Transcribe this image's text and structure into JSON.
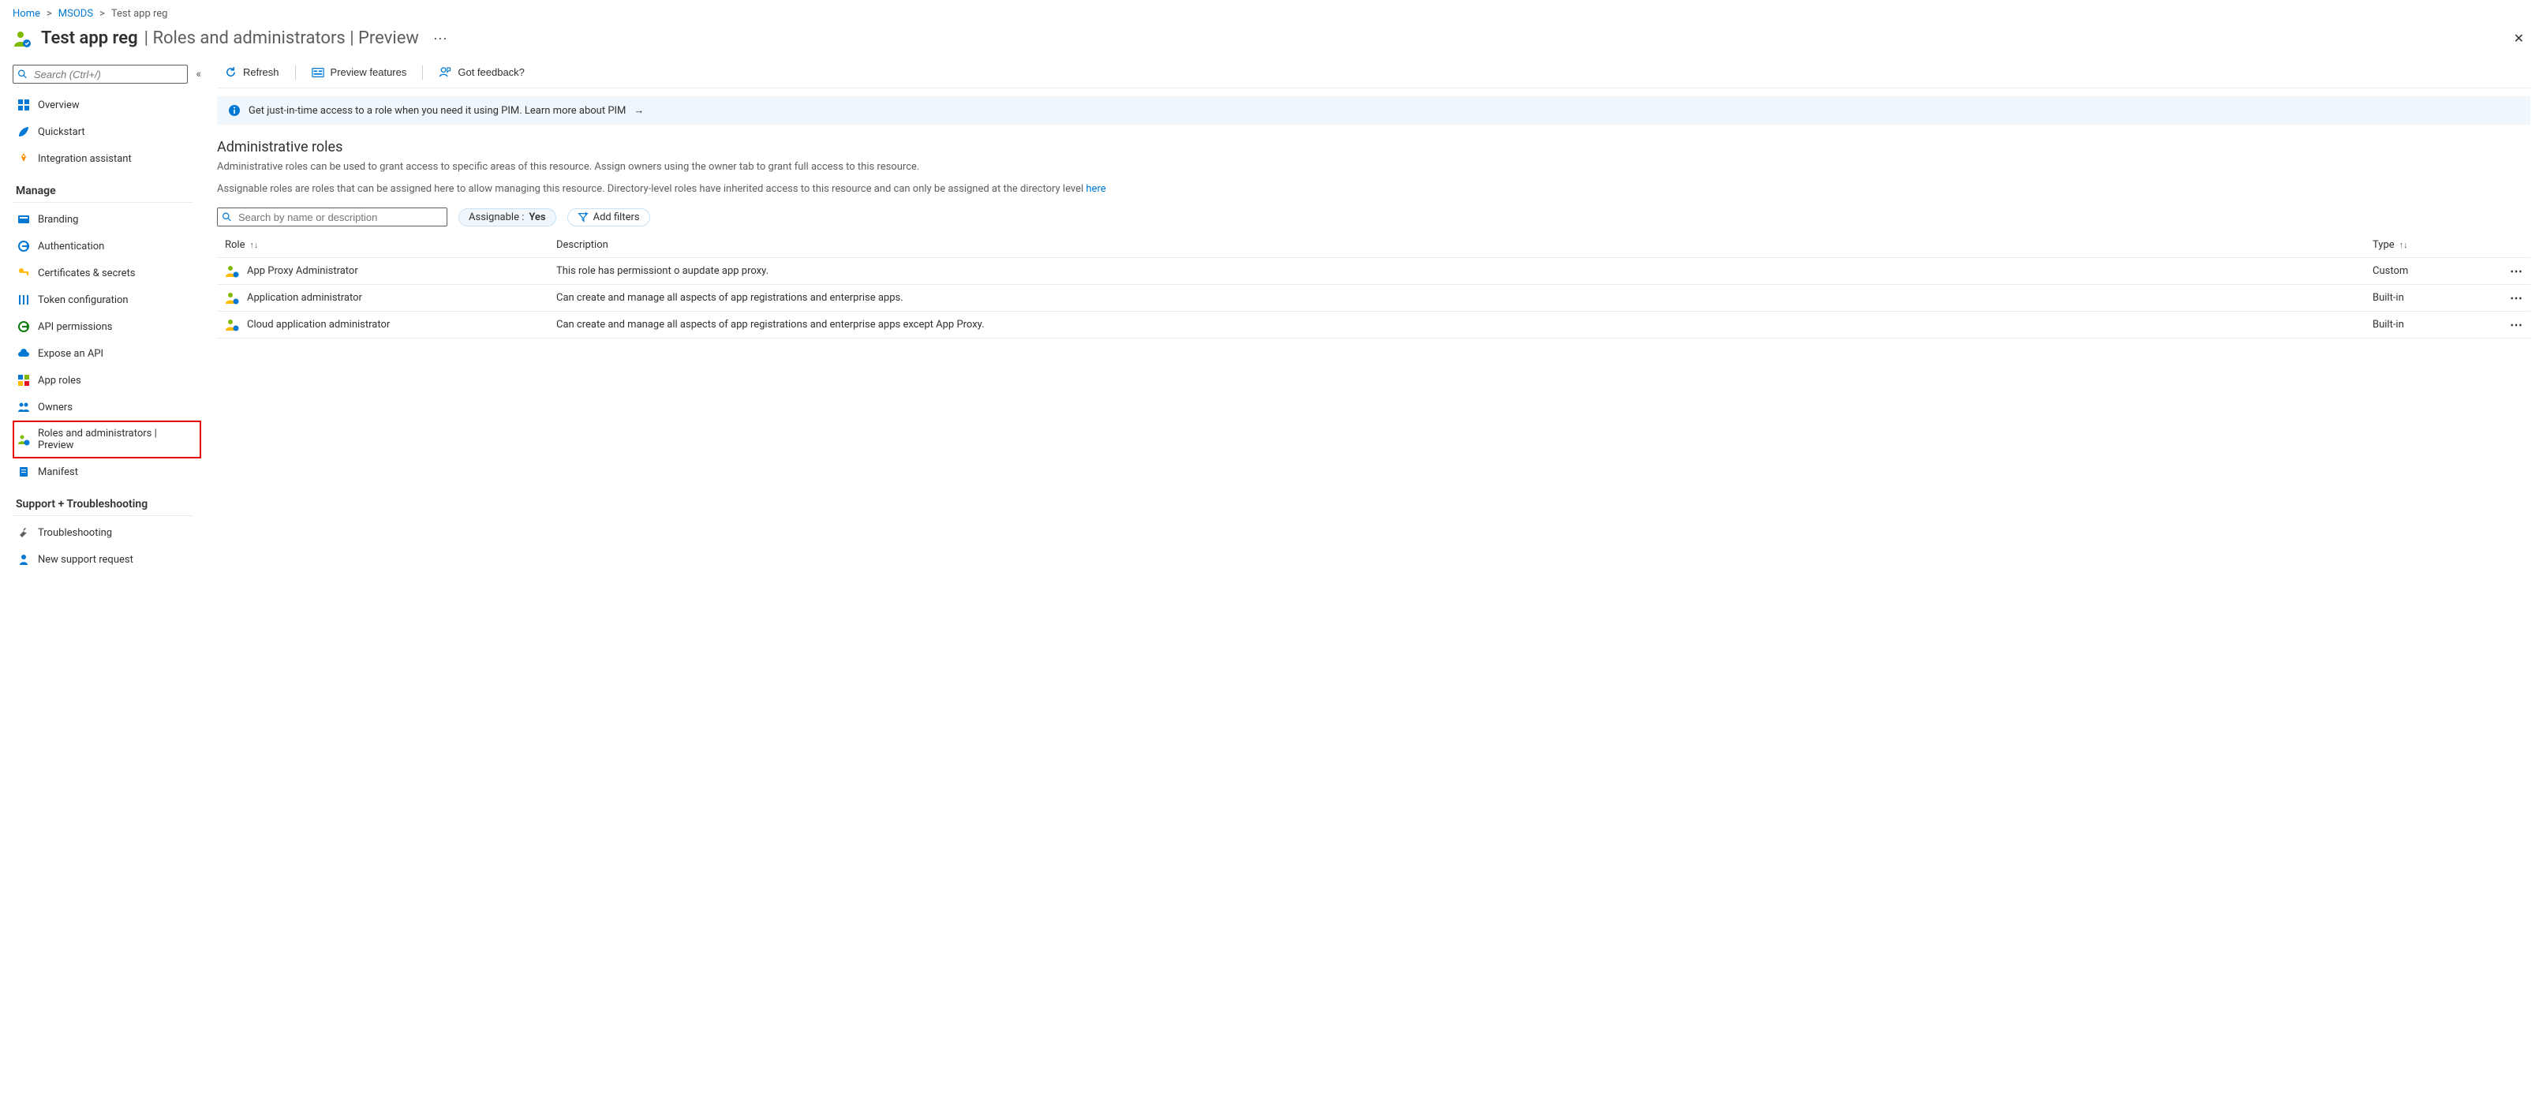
{
  "breadcrumb": {
    "home": "Home",
    "msods": "MSODS",
    "current": "Test app reg"
  },
  "header": {
    "title_strong": "Test app reg",
    "title_sep": " | ",
    "title_light": "Roles and administrators | Preview"
  },
  "sidebar": {
    "search_placeholder": "Search (Ctrl+/)",
    "items_top": [
      {
        "id": "overview",
        "label": "Overview",
        "icon": "overview"
      },
      {
        "id": "quickstart",
        "label": "Quickstart",
        "icon": "quickstart"
      },
      {
        "id": "integration",
        "label": "Integration assistant",
        "icon": "rocket"
      }
    ],
    "section_manage": "Manage",
    "items_manage": [
      {
        "id": "branding",
        "label": "Branding",
        "icon": "branding"
      },
      {
        "id": "authentication",
        "label": "Authentication",
        "icon": "auth"
      },
      {
        "id": "certificates",
        "label": "Certificates & secrets",
        "icon": "key"
      },
      {
        "id": "token-config",
        "label": "Token configuration",
        "icon": "token"
      },
      {
        "id": "api-permissions",
        "label": "API permissions",
        "icon": "api-perm"
      },
      {
        "id": "expose-api",
        "label": "Expose an API",
        "icon": "cloud"
      },
      {
        "id": "app-roles",
        "label": "App roles",
        "icon": "app-roles"
      },
      {
        "id": "owners",
        "label": "Owners",
        "icon": "owners"
      },
      {
        "id": "roles-admins",
        "label": "Roles and administrators | Preview",
        "icon": "roles",
        "highlighted": true
      },
      {
        "id": "manifest",
        "label": "Manifest",
        "icon": "manifest"
      }
    ],
    "section_support": "Support + Troubleshooting",
    "items_support": [
      {
        "id": "troubleshooting",
        "label": "Troubleshooting",
        "icon": "wrench"
      },
      {
        "id": "new-support",
        "label": "New support request",
        "icon": "support"
      }
    ]
  },
  "toolbar": {
    "refresh": "Refresh",
    "preview_features": "Preview features",
    "got_feedback": "Got feedback?"
  },
  "banner": {
    "text": "Get just-in-time access to a role when you need it using PIM. Learn more about PIM"
  },
  "section": {
    "title": "Administrative roles",
    "desc1": "Administrative roles can be used to grant access to specific areas of this resource. Assign owners using the owner tab to grant full access to this resource.",
    "desc2_a": "Assignable roles are roles that can be assigned here to allow managing this resource. Directory-level roles have inherited access to this resource and can only be assigned at the directory level ",
    "desc2_link": "here"
  },
  "filters": {
    "search_placeholder": "Search by name or description",
    "assignable_label": "Assignable :",
    "assignable_value": "Yes",
    "add_filters": "Add filters"
  },
  "table": {
    "col_role": "Role",
    "col_description": "Description",
    "col_type": "Type",
    "rows": [
      {
        "role": "App Proxy Administrator",
        "description": "This role has permissiont o aupdate app proxy.",
        "type": "Custom"
      },
      {
        "role": "Application administrator",
        "description": "Can create and manage all aspects of app registrations and enterprise apps.",
        "type": "Built-in"
      },
      {
        "role": "Cloud application administrator",
        "description": "Can create and manage all aspects of app registrations and enterprise apps except App Proxy.",
        "type": "Built-in"
      }
    ]
  }
}
